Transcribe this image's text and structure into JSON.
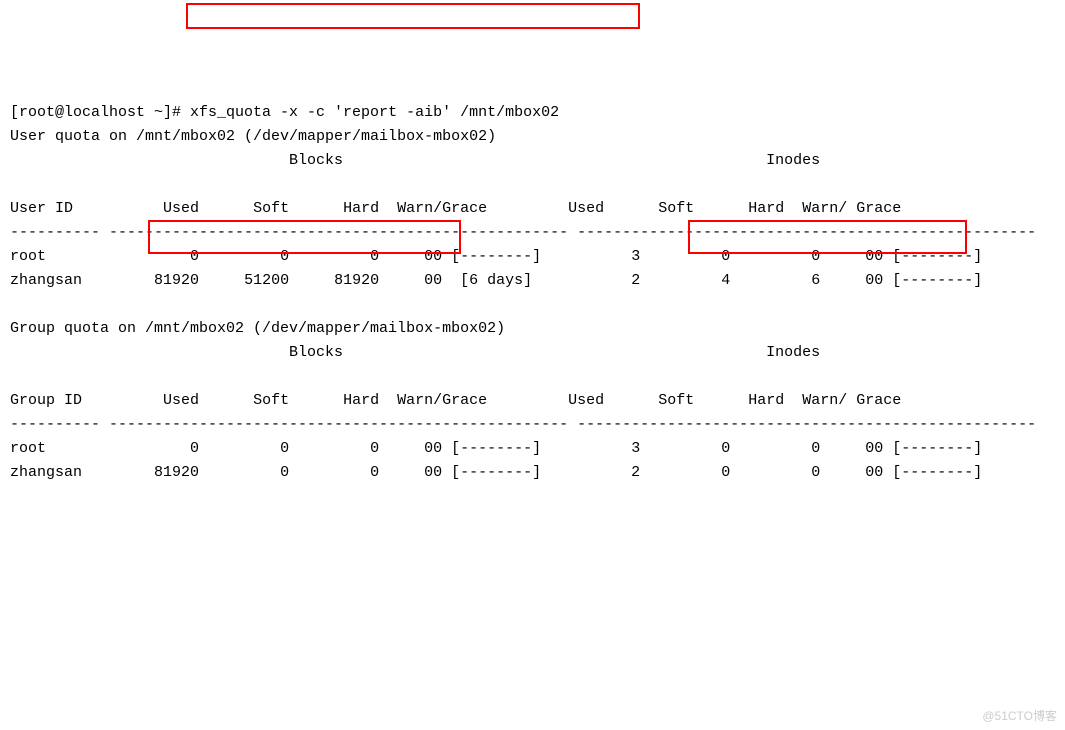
{
  "prompt": {
    "user_host": "[root@localhost ~]# ",
    "command": "xfs_quota -x -c 'report -aib' /mnt/mbox02"
  },
  "user_section": {
    "title": "User quota on /mnt/mbox02 (/dev/mapper/mailbox-mbox02)",
    "blocks_header": "Blocks",
    "inodes_header": "Inodes",
    "columns": {
      "idlabel": "User ID",
      "used": "Used",
      "soft": "Soft",
      "hard": "Hard",
      "warn": "Warn/Grace",
      "warn2": "Warn/ Grace"
    },
    "rows": [
      {
        "name": "root",
        "b_used": "0",
        "b_soft": "0",
        "b_hard": "0",
        "b_warn": "00 [--------]",
        "i_used": "3",
        "i_soft": "0",
        "i_hard": "0",
        "i_warn": "00 [--------]"
      },
      {
        "name": "zhangsan",
        "b_used": "81920",
        "b_soft": "51200",
        "b_hard": "81920",
        "b_warn": "00  [6 days]",
        "i_used": "2",
        "i_soft": "4",
        "i_hard": "6",
        "i_warn": "00 [--------]"
      }
    ]
  },
  "group_section": {
    "title": "Group quota on /mnt/mbox02 (/dev/mapper/mailbox-mbox02)",
    "blocks_header": "Blocks",
    "inodes_header": "Inodes",
    "columns": {
      "idlabel": "Group ID",
      "used": "Used",
      "soft": "Soft",
      "hard": "Hard",
      "warn": "Warn/Grace",
      "warn2": "Warn/ Grace"
    },
    "rows": [
      {
        "name": "root",
        "b_used": "0",
        "b_soft": "0",
        "b_hard": "0",
        "b_warn": "00 [--------]",
        "i_used": "3",
        "i_soft": "0",
        "i_hard": "0",
        "i_warn": "00 [--------]"
      },
      {
        "name": "zhangsan",
        "b_used": "81920",
        "b_soft": "0",
        "b_hard": "0",
        "b_warn": "00 [--------]",
        "i_used": "2",
        "i_soft": "0",
        "i_hard": "0",
        "i_warn": "00 [--------]"
      }
    ]
  },
  "dashes": {
    "d10": "----------",
    "d1": "-",
    "d6": "------"
  },
  "watermark": "@51CTO博客"
}
